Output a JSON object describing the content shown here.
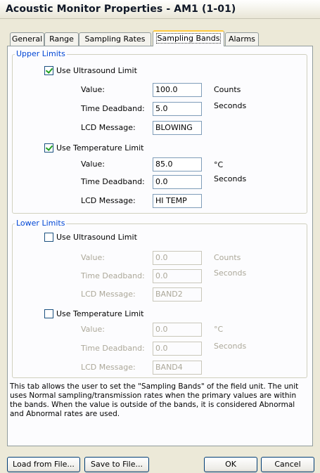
{
  "window": {
    "title": "Acoustic Monitor Properties - AM1 (1-01)"
  },
  "tabs": [
    "General",
    "Range",
    "Sampling Rates",
    "Sampling Bands",
    "Alarms"
  ],
  "upper_limits": {
    "legend": "Upper Limits",
    "ultrasound": {
      "label": "Use Ultrasound Limit",
      "checked": true,
      "value_label": "Value:",
      "value": "100.0",
      "value_unit": "Counts",
      "deadband_label": "Time Deadband:",
      "deadband": "5.0",
      "deadband_unit": "Seconds",
      "lcd_label": "LCD Message:",
      "lcd": "BLOWING"
    },
    "temperature": {
      "label": "Use Temperature Limit",
      "checked": true,
      "value_label": "Value:",
      "value": "85.0",
      "value_unit": "°C",
      "deadband_label": "Time Deadband:",
      "deadband": "0.0",
      "deadband_unit": "Seconds",
      "lcd_label": "LCD Message:",
      "lcd": "HI TEMP"
    }
  },
  "lower_limits": {
    "legend": "Lower Limits",
    "ultrasound": {
      "label": "Use Ultrasound Limit",
      "checked": false,
      "value_label": "Value:",
      "value": "0.0",
      "value_unit": "Counts",
      "deadband_label": "Time Deadband:",
      "deadband": "0.0",
      "deadband_unit": "Seconds",
      "lcd_label": "LCD Message:",
      "lcd": "BAND2"
    },
    "temperature": {
      "label": "Use Temperature Limit",
      "checked": false,
      "value_label": "Value:",
      "value": "0.0",
      "value_unit": "°C",
      "deadband_label": "Time Deadband:",
      "deadband": "0.0",
      "deadband_unit": "Seconds",
      "lcd_label": "LCD Message:",
      "lcd": "BAND4"
    }
  },
  "description": "This tab allows the user to set the \"Sampling Bands\" of the field unit. The unit uses Normal sampling/transmission rates when the primary values are within the bands.  When the value is outside of the bands, it is considered Abnormal and Abnormal rates are used.",
  "buttons": {
    "load": "Load from File...",
    "save": "Save to File...",
    "ok": "OK",
    "cancel": "Cancel"
  },
  "colors": {
    "legend": "#0046d5",
    "tab_highlight": "#ffc83c",
    "disabled_text": "#aca899"
  }
}
